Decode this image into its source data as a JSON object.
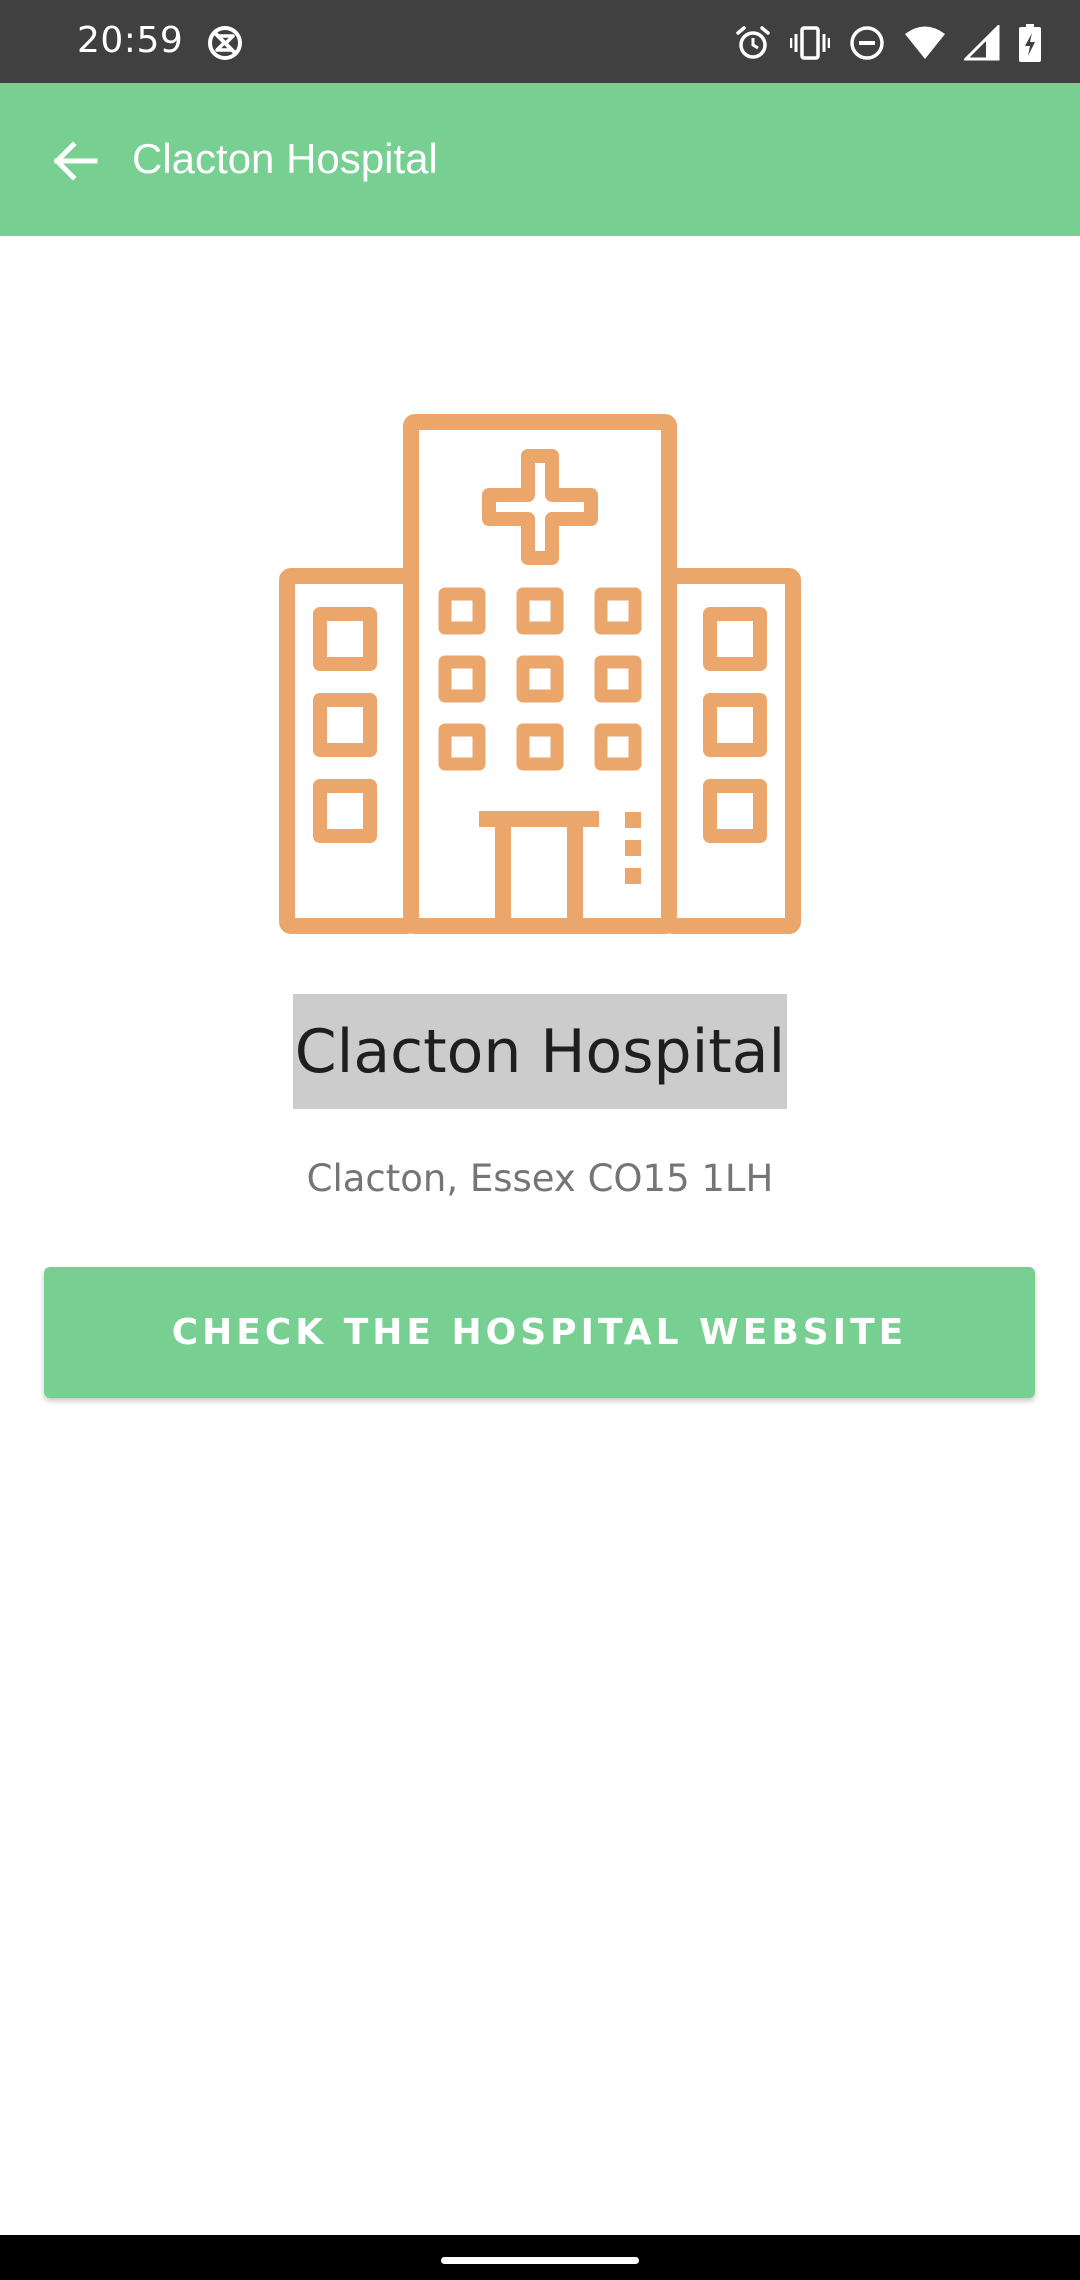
{
  "status_bar": {
    "time": "20:59",
    "icons": [
      "no-sync-icon",
      "alarm-icon",
      "vibrate-icon",
      "do-not-disturb-icon",
      "wifi-icon",
      "signal-icon",
      "battery-charging-icon"
    ]
  },
  "app_bar": {
    "title": "Clacton Hospital",
    "back_icon": "arrow-back-icon",
    "color": "#77cf92"
  },
  "hospital": {
    "illustration_icon": "hospital-building-icon",
    "illustration_color": "#eba66c",
    "name": "Clacton Hospital",
    "address": "Clacton, Essex CO15 1LH"
  },
  "actions": {
    "website_button_label": "CHECK THE HOSPITAL WEBSITE"
  }
}
